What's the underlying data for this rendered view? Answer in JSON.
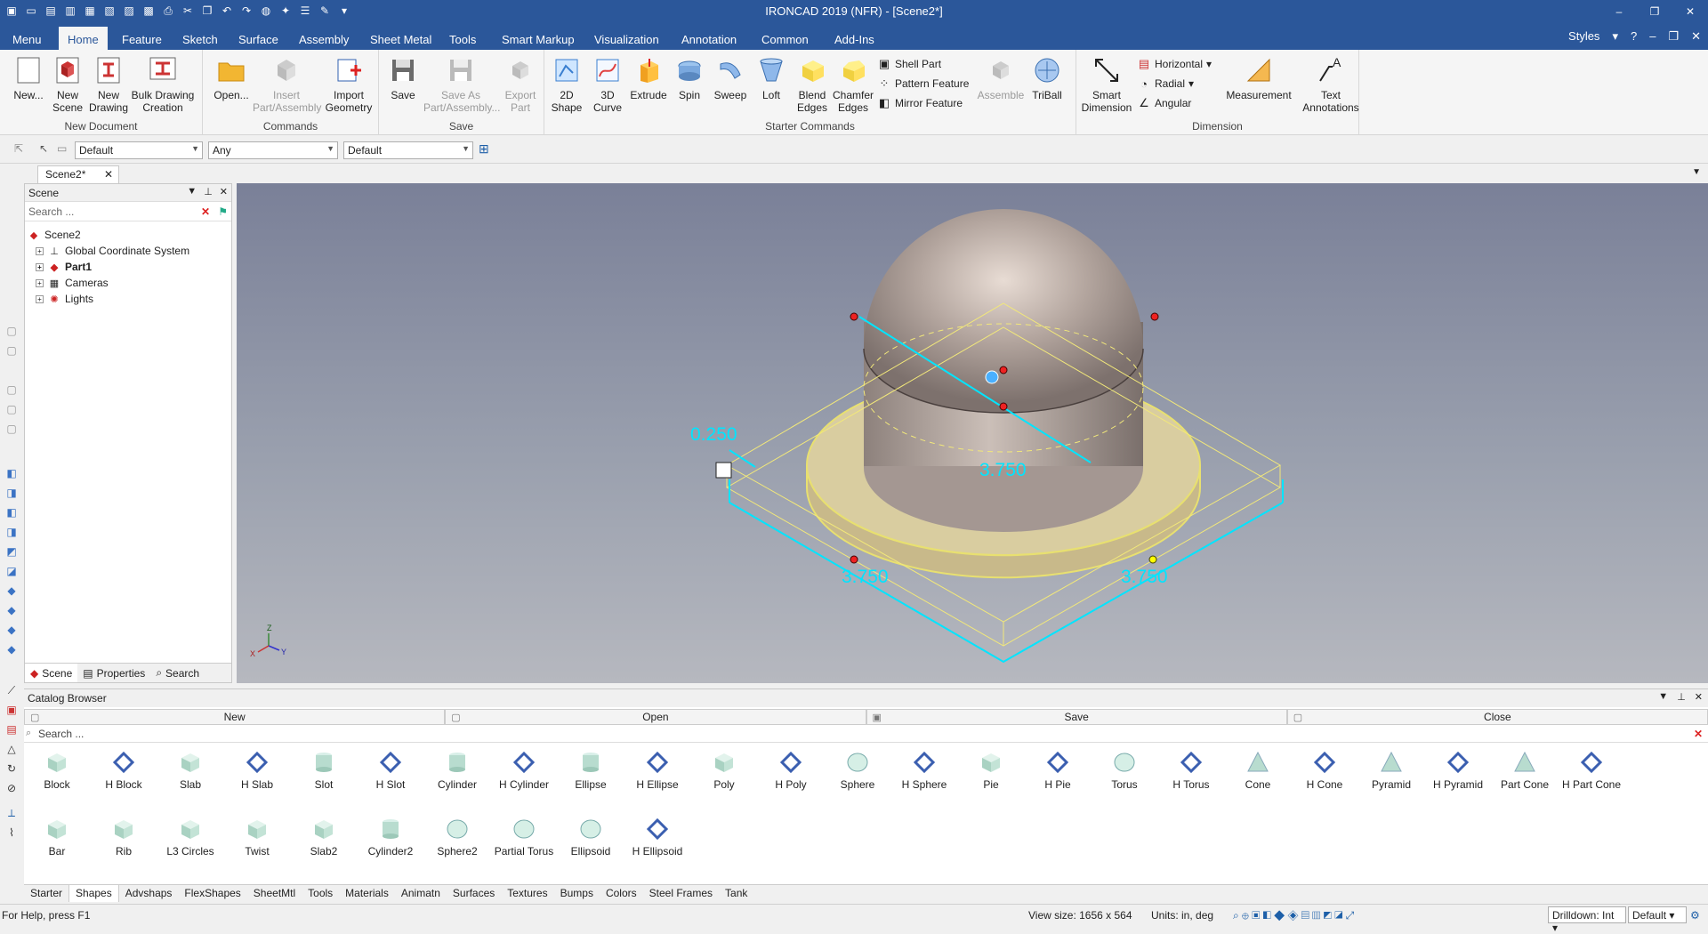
{
  "window": {
    "title": "IRONCAD 2019 (NFR) - [Scene2*]",
    "controls": [
      "–",
      "❐",
      "✕"
    ]
  },
  "ribbon_tabs": [
    "Menu",
    "Home",
    "Feature",
    "Sketch",
    "Surface",
    "Assembly",
    "Sheet Metal",
    "Tools",
    "Smart Markup",
    "Visualization",
    "Annotation",
    "Common",
    "Add-Ins"
  ],
  "active_tab": "Home",
  "styles_label": "Styles",
  "groups": {
    "new_document": {
      "label": "New Document",
      "buttons": [
        {
          "label": "New...",
          "icon": "new-doc-icon"
        },
        {
          "label": "New Scene",
          "icon": "new-scene-icon"
        },
        {
          "label": "New Drawing",
          "icon": "new-drawing-icon"
        },
        {
          "label": "Bulk Drawing Creation",
          "icon": "bulk-drawing-icon"
        }
      ]
    },
    "commands": {
      "label": "Commands",
      "buttons": [
        {
          "label": "Open...",
          "icon": "folder-icon"
        },
        {
          "label": "Insert Part/Assembly",
          "icon": "insert-part-icon"
        },
        {
          "label": "Import Geometry",
          "icon": "import-geometry-icon"
        }
      ]
    },
    "save": {
      "label": "Save",
      "buttons": [
        {
          "label": "Save",
          "icon": "save-icon"
        },
        {
          "label": "Save As Part/Assembly...",
          "icon": "save-as-icon"
        },
        {
          "label": "Export Part",
          "icon": "export-part-icon"
        }
      ]
    },
    "starter": {
      "label": "Starter Commands",
      "buttons": [
        {
          "label": "2D Shape",
          "icon": "2d-shape-icon"
        },
        {
          "label": "3D Curve",
          "icon": "3d-curve-icon"
        },
        {
          "label": "Extrude",
          "icon": "extrude-icon"
        },
        {
          "label": "Spin",
          "icon": "spin-icon"
        },
        {
          "label": "Sweep",
          "icon": "sweep-icon"
        },
        {
          "label": "Loft",
          "icon": "loft-icon"
        },
        {
          "label": "Blend Edges",
          "icon": "blend-edges-icon"
        },
        {
          "label": "Chamfer Edges",
          "icon": "chamfer-edges-icon"
        },
        {
          "label": "Assemble",
          "icon": "assemble-icon"
        },
        {
          "label": "TriBall",
          "icon": "triball-icon"
        }
      ],
      "small": [
        "Shell Part",
        "Pattern Feature",
        "Mirror Feature"
      ]
    },
    "dimension": {
      "label": "Dimension",
      "buttons": [
        {
          "label": "Smart Dimension",
          "icon": "smart-dimension-icon"
        },
        {
          "label": "Measurement",
          "icon": "measurement-icon"
        },
        {
          "label": "Text Annotations",
          "icon": "text-annotations-icon"
        }
      ],
      "small": [
        "Horizontal",
        "Radial",
        "Angular"
      ]
    }
  },
  "toolbar": {
    "combo1": "Default",
    "combo2": "Any",
    "combo3": "Default"
  },
  "document_tab": "Scene2*",
  "scene_panel": {
    "title": "Scene",
    "search_placeholder": "Search ...",
    "tree": [
      {
        "label": "Scene2",
        "bold": false
      },
      {
        "label": "Global Coordinate System",
        "bold": false
      },
      {
        "label": "Part1",
        "bold": true
      },
      {
        "label": "Cameras",
        "bold": false
      },
      {
        "label": "Lights",
        "bold": false
      }
    ],
    "tabs": [
      "Scene",
      "Properties",
      "Search"
    ]
  },
  "viewport": {
    "dims": [
      "0.250",
      "3.750",
      "3.750",
      "3.750"
    ],
    "axes": [
      "Z",
      "X",
      "Y"
    ]
  },
  "catalog": {
    "title": "Catalog Browser",
    "actions": [
      "New",
      "Open",
      "Save",
      "Close"
    ],
    "search_placeholder": "Search ...",
    "row1": [
      "Block",
      "H Block",
      "Slab",
      "H Slab",
      "Slot",
      "H Slot",
      "Cylinder",
      "H Cylinder",
      "Ellipse",
      "H Ellipse",
      "Poly",
      "H Poly",
      "Sphere",
      "H Sphere",
      "Pie",
      "H Pie",
      "Torus",
      "H Torus",
      "Cone",
      "H Cone",
      "Pyramid",
      "H Pyramid",
      "Part Cone",
      "H Part Cone"
    ],
    "row2": [
      "Bar",
      "Rib",
      "L3 Circles",
      "Twist",
      "Slab2",
      "Cylinder2",
      "Sphere2",
      "Partial Torus",
      "Ellipsoid",
      "H Ellipsoid"
    ],
    "tabs": [
      "Starter",
      "Shapes",
      "Advshaps",
      "FlexShapes",
      "SheetMtl",
      "Tools",
      "Materials",
      "Animatn",
      "Surfaces",
      "Textures",
      "Bumps",
      "Colors",
      "Steel Frames",
      "Tank"
    ],
    "active_tab": "Shapes"
  },
  "status": {
    "help": "For Help, press F1",
    "view_size": "View size: 1656 x  564",
    "units": "Units: in, deg",
    "drilldown": "Drilldown: Int",
    "mode": "Default"
  },
  "colors": {
    "title_bar": "#2b579a",
    "dimension": "#00e5ff",
    "highlight": "#e8e070"
  }
}
